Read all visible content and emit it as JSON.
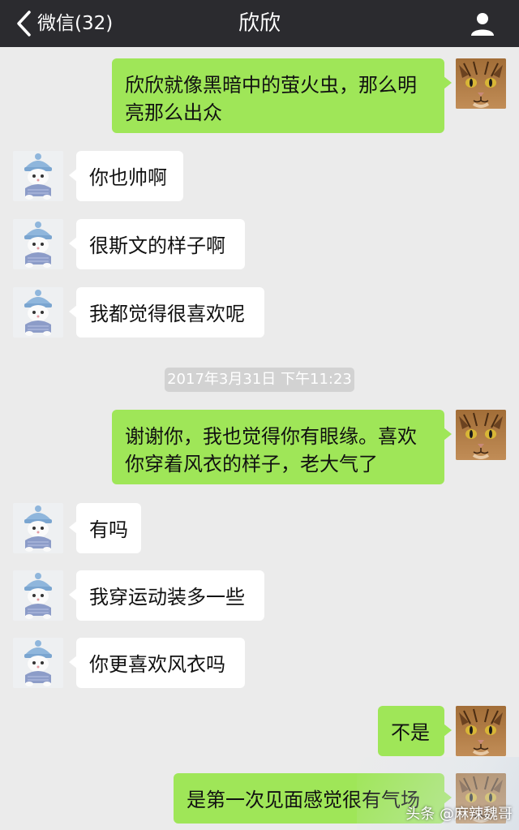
{
  "header": {
    "back_label": "微信(32)",
    "title": "欣欣",
    "contact_icon": "person-icon",
    "bg_color": "#2b2b2f"
  },
  "colors": {
    "outgoing_bubble": "#9fe658",
    "incoming_bubble": "#ffffff",
    "background": "#ebebeb"
  },
  "messages": [
    {
      "side": "out",
      "avatar": "tabby-cat-avatar",
      "text": "欣欣就像黑暗中的萤火虫，那么明亮那么出众"
    },
    {
      "side": "in",
      "avatar": "kitten-beanie-avatar",
      "text": "你也帅啊"
    },
    {
      "side": "in",
      "avatar": "kitten-beanie-avatar",
      "text": "很斯文的样子啊"
    },
    {
      "side": "in",
      "avatar": "kitten-beanie-avatar",
      "text": "我都觉得很喜欢呢"
    },
    {
      "side": "out",
      "avatar": "tabby-cat-avatar",
      "text": "谢谢你，我也觉得你有眼缘。喜欢你穿着风衣的样子，老大气了"
    },
    {
      "side": "in",
      "avatar": "kitten-beanie-avatar",
      "text": "有吗"
    },
    {
      "side": "in",
      "avatar": "kitten-beanie-avatar",
      "text": "我穿运动装多一些"
    },
    {
      "side": "in",
      "avatar": "kitten-beanie-avatar",
      "text": "你更喜欢风衣吗"
    },
    {
      "side": "out",
      "avatar": "tabby-cat-avatar",
      "text": "不是"
    },
    {
      "side": "out",
      "avatar": "tabby-cat-avatar",
      "text": "是第一次见面感觉很有气场"
    }
  ],
  "timestamp": "2017年3月31日 下午11:23",
  "watermark": "头条 @麻辣魏哥"
}
